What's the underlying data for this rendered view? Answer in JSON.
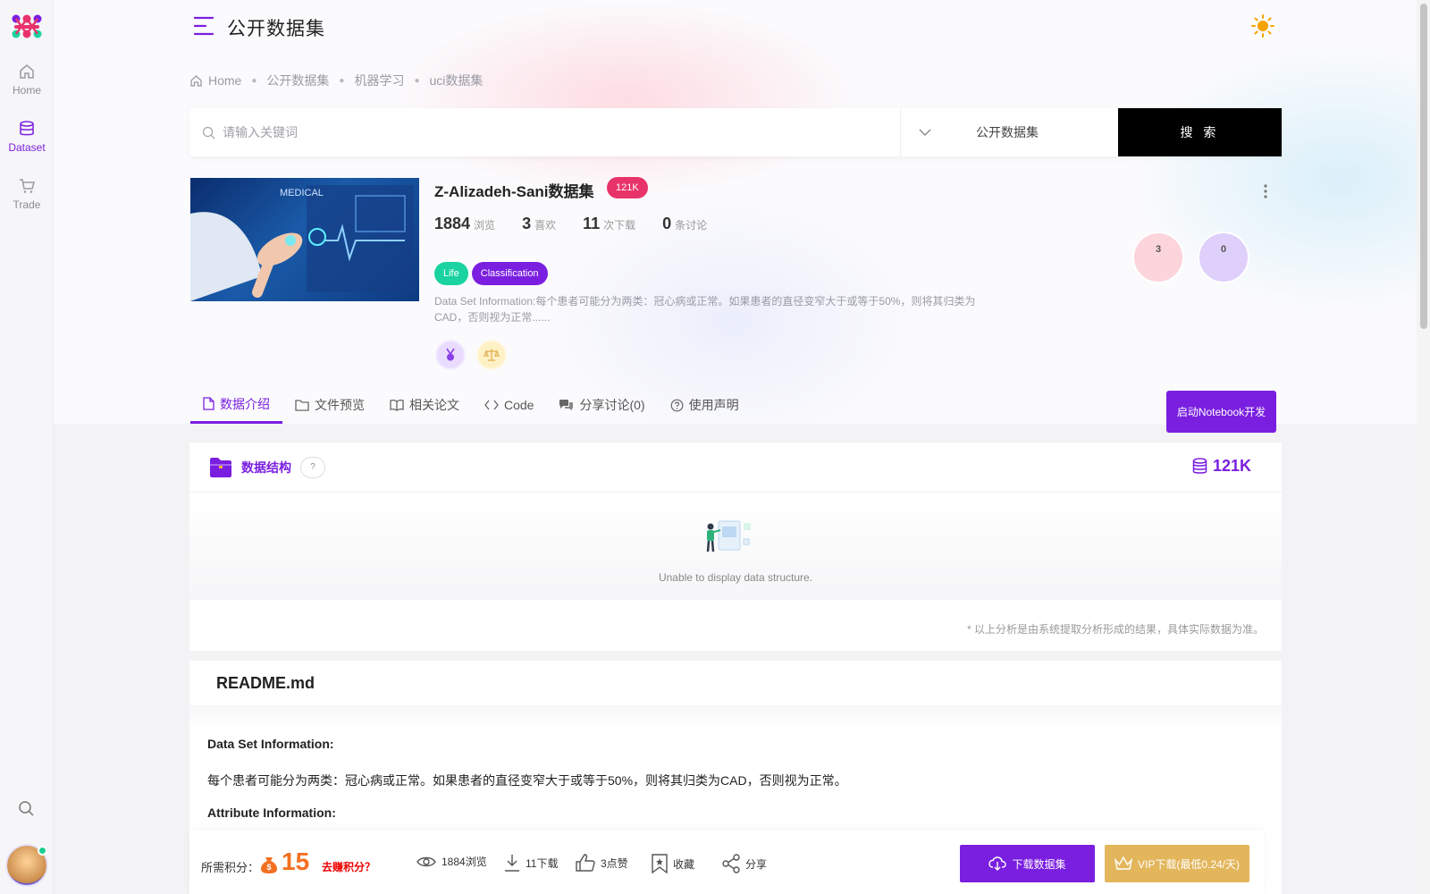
{
  "sidebar": {
    "items": [
      {
        "label": "Home",
        "icon": "home-icon"
      },
      {
        "label": "Dataset",
        "icon": "database-icon",
        "active": true
      },
      {
        "label": "Trade",
        "icon": "cart-icon"
      }
    ]
  },
  "header": {
    "title": "公开数据集"
  },
  "breadcrumb": [
    "Home",
    "公开数据集",
    "机器学习",
    "uci数据集"
  ],
  "search": {
    "placeholder": "请输入关键词",
    "category": "公开数据集",
    "button": "搜 索"
  },
  "dataset": {
    "title": "Z-Alizadeh-Sani数据集",
    "size_badge": "121K",
    "stats": [
      {
        "value": "1884",
        "label": "浏览"
      },
      {
        "value": "3",
        "label": "喜欢"
      },
      {
        "value": "11",
        "label": "次下载"
      },
      {
        "value": "0",
        "label": "条讨论"
      }
    ],
    "tags": [
      "Life",
      "Classification"
    ],
    "description": "Data Set Information:每个患者可能分为两类：冠心病或正常。如果患者的直径变窄大于或等于50%，则将其归类为CAD，否则视为正常......",
    "bubbles": [
      "3",
      "0"
    ]
  },
  "tabs": [
    {
      "label": "数据介绍",
      "icon": "file-icon",
      "active": true
    },
    {
      "label": "文件预览",
      "icon": "folder-icon"
    },
    {
      "label": "相关论文",
      "icon": "book-icon"
    },
    {
      "label": "Code",
      "icon": "code-icon"
    },
    {
      "label": "分享讨论(0)",
      "icon": "chat-icon"
    },
    {
      "label": "使用声明",
      "icon": "question-icon"
    }
  ],
  "notebook_button": "启动Notebook开发",
  "structure": {
    "title": "数据结构",
    "help": "?",
    "size": "121K",
    "empty_text": "Unable to display data structure.",
    "note": "* 以上分析是由系统提取分析形成的结果，具体实际数据为准。"
  },
  "readme": {
    "filename": "README.md",
    "h1": "Data Set Information:",
    "p1": "每个患者可能分为两类：冠心病或正常。如果患者的直径变窄大于或等于50%，则将其归类为CAD，否则视为正常。",
    "h2": "Attribute Information:"
  },
  "bottom_bar": {
    "points_label": "所需积分：",
    "points": "15",
    "earn_link": "去赚积分？",
    "views": "1884浏览",
    "downloads": "11下载",
    "likes": "3点赞",
    "favorite": "收藏",
    "share": "分享",
    "download_button": "下载数据集",
    "vip_button": "VIP下载(最低0.24/天)"
  },
  "colors": {
    "accent": "#7a1fe0",
    "badge": "#e8336a",
    "life_tag": "#1ad3a0",
    "vip": "#e3b65c",
    "points": "#f37021"
  }
}
